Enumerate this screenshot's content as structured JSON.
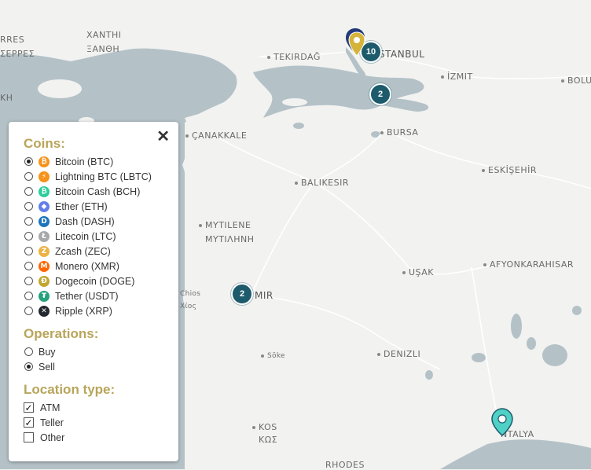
{
  "map": {
    "cities": {
      "xanthi": "ΞΑΝΘΗ",
      "xanthi_latin": "XANTHI",
      "serres": "ΣΕΡΡΕΣ",
      "serres_latin": "RRES",
      "tekirdag": "TEKIRDAĞ",
      "istanbul": "ISTANBUL",
      "izmit": "İZMIT",
      "bolu": "BOLU",
      "canakkale": "ÇANAKKALE",
      "bursa": "BURSA",
      "eskisehir": "ESKİŞEHİR",
      "balikesir": "BALIKESIR",
      "mytilene": "MYTILENE",
      "mytilene_greek": "ΜΥΤΙΛΗΝΗ",
      "usak": "UŞAK",
      "afyonkarahisar": "AFYONKARAHISAR",
      "izmir": "MIR",
      "chios": "Chios",
      "chios_greek": "Χίος",
      "denizli": "DENIZLI",
      "soke": "Söke",
      "kos": "KOS",
      "kos_greek": "ΚΩΣ",
      "antalya": "NTALYA",
      "rhodes": "RHODES",
      "kh": "KH"
    },
    "clusters": {
      "istanbul": "10",
      "marmara": "2",
      "izmir": "2"
    },
    "colors": {
      "sea": "#b4c2c8",
      "land": "#f2f2f0",
      "cluster": "#1d5a6c",
      "pin_teal": "#4fd1c5",
      "pin_gold": "#d4b43a",
      "pin_blue": "#233a7a"
    }
  },
  "panel": {
    "close_label": "✕",
    "coins_title": "Coins:",
    "coins": [
      {
        "label": "Bitcoin (BTC)",
        "icon": "bitcoin-icon",
        "symbol": "₿",
        "color": "#f7931a",
        "selected": true
      },
      {
        "label": "Lightning BTC (LBTC)",
        "icon": "lightning-icon",
        "symbol": "⚡",
        "color": "#f7931a",
        "selected": false
      },
      {
        "label": "Bitcoin Cash (BCH)",
        "icon": "bitcoin-cash-icon",
        "symbol": "₿",
        "color": "#2ecc9a",
        "selected": false
      },
      {
        "label": "Ether (ETH)",
        "icon": "ether-icon",
        "symbol": "◆",
        "color": "#627eea",
        "selected": false
      },
      {
        "label": "Dash (DASH)",
        "icon": "dash-icon",
        "symbol": "D",
        "color": "#1c75bc",
        "selected": false
      },
      {
        "label": "Litecoin (LTC)",
        "icon": "litecoin-icon",
        "symbol": "Ł",
        "color": "#a6a9aa",
        "selected": false
      },
      {
        "label": "Zcash (ZEC)",
        "icon": "zcash-icon",
        "symbol": "Z",
        "color": "#ecb244",
        "selected": false
      },
      {
        "label": "Monero (XMR)",
        "icon": "monero-icon",
        "symbol": "M",
        "color": "#ff6600",
        "selected": false
      },
      {
        "label": "Dogecoin (DOGE)",
        "icon": "dogecoin-icon",
        "symbol": "Ð",
        "color": "#c2a633",
        "selected": false
      },
      {
        "label": "Tether (USDT)",
        "icon": "tether-icon",
        "symbol": "₮",
        "color": "#26a17b",
        "selected": false
      },
      {
        "label": "Ripple (XRP)",
        "icon": "ripple-icon",
        "symbol": "✕",
        "color": "#23292f",
        "selected": false
      }
    ],
    "operations_title": "Operations:",
    "operations": [
      {
        "label": "Buy",
        "selected": false
      },
      {
        "label": "Sell",
        "selected": true
      }
    ],
    "location_title": "Location type:",
    "locations": [
      {
        "label": "ATM",
        "checked": true
      },
      {
        "label": "Teller",
        "checked": true
      },
      {
        "label": "Other",
        "checked": false
      }
    ]
  }
}
